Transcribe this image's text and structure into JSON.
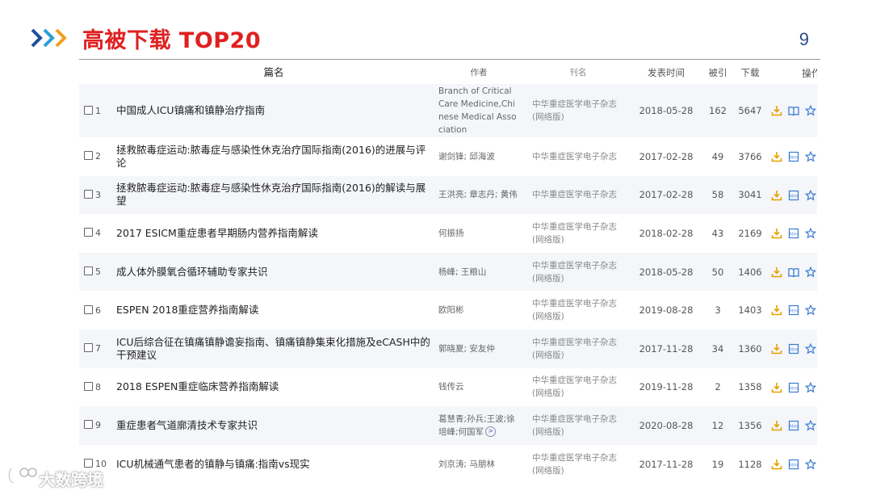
{
  "header": {
    "title": "高被下载 TOP20",
    "page_number": "9",
    "title_color": "#e02020"
  },
  "table": {
    "columns": {
      "title": "篇名",
      "author": "作者",
      "journal": "刊名",
      "date": "发表时间",
      "cited": "被引",
      "downloads": "下载",
      "ops": "操作"
    },
    "rows": [
      {
        "num": "1",
        "title": "中国成人ICU镇痛和镇静治疗指南",
        "author": "Branch of Critical Care Medicine,Chinese Medical Association",
        "journal": "中华重症医学电子杂志(网络版)",
        "date": "2018-05-28",
        "cited": "162",
        "downloads": "5647",
        "read_icon": "book-icon"
      },
      {
        "num": "2",
        "title": "拯救脓毒症运动:脓毒症与感染性休克治疗国际指南(2016)的进展与评论",
        "author": "谢剑锋; 邱海波",
        "journal": "中华重症医学电子杂志",
        "date": "2017-02-28",
        "cited": "49",
        "downloads": "3766",
        "read_icon": "html-icon"
      },
      {
        "num": "3",
        "title": "拯救脓毒症运动:脓毒症与感染性休克治疗国际指南(2016)的解读与展望",
        "author": "王洪亮; 章志丹; 黄伟",
        "journal": "中华重症医学电子杂志",
        "date": "2017-02-28",
        "cited": "58",
        "downloads": "3041",
        "read_icon": "html-icon"
      },
      {
        "num": "4",
        "title": "2017 ESICM重症患者早期肠内营养指南解读",
        "author": "何振扬",
        "journal": "中华重症医学电子杂志(网络版)",
        "date": "2018-02-28",
        "cited": "43",
        "downloads": "2169",
        "read_icon": "html-icon"
      },
      {
        "num": "5",
        "title": "成人体外膜氧合循环辅助专家共识",
        "author": "杨峰; 王粮山",
        "journal": "中华重症医学电子杂志(网络版)",
        "date": "2018-05-28",
        "cited": "50",
        "downloads": "1406",
        "read_icon": "book-icon"
      },
      {
        "num": "6",
        "title": "ESPEN 2018重症营养指南解读",
        "author": "欧阳彬",
        "journal": "中华重症医学电子杂志(网络版)",
        "date": "2019-08-28",
        "cited": "3",
        "downloads": "1403",
        "read_icon": "html-icon"
      },
      {
        "num": "7",
        "title": "ICU后综合征在镇痛镇静谵妄指南、镇痛镇静集束化措施及eCASH中的干预建议",
        "author": "郭晓夏; 安友仲",
        "journal": "中华重症医学电子杂志(网络版)",
        "date": "2017-11-28",
        "cited": "34",
        "downloads": "1360",
        "read_icon": "html-icon"
      },
      {
        "num": "8",
        "title": "2018 ESPEN重症临床营养指南解读",
        "author": "钱传云",
        "journal": "中华重症医学电子杂志(网络版)",
        "date": "2019-11-28",
        "cited": "2",
        "downloads": "1358",
        "read_icon": "html-icon"
      },
      {
        "num": "9",
        "title": "重症患者气道廓清技术专家共识",
        "author": "葛慧青;孙兵;王波;徐培峰;何国军",
        "journal": "中华重症医学电子杂志(网络版)",
        "date": "2020-08-28",
        "cited": "12",
        "downloads": "1356",
        "read_icon": "html-icon",
        "author_more": ">"
      },
      {
        "num": "10",
        "title": "ICU机械通气患者的镇静与镇痛:指南vs现实",
        "author": "刘京涛; 马朋林",
        "journal": "中华重症医学电子杂志(网络版)",
        "date": "2017-11-28",
        "cited": "19",
        "downloads": "1128",
        "read_icon": "html-icon"
      }
    ]
  },
  "watermark": {
    "text": "大数跨境"
  },
  "colors": {
    "download": "#e8a000",
    "read": "#3a7bd5",
    "fav": "#3a7bd5",
    "quote": "#3a7bd5",
    "chevron_a": "#1f4e99",
    "chevron_b": "#2a9fd6",
    "chevron_c": "#f0a020"
  }
}
